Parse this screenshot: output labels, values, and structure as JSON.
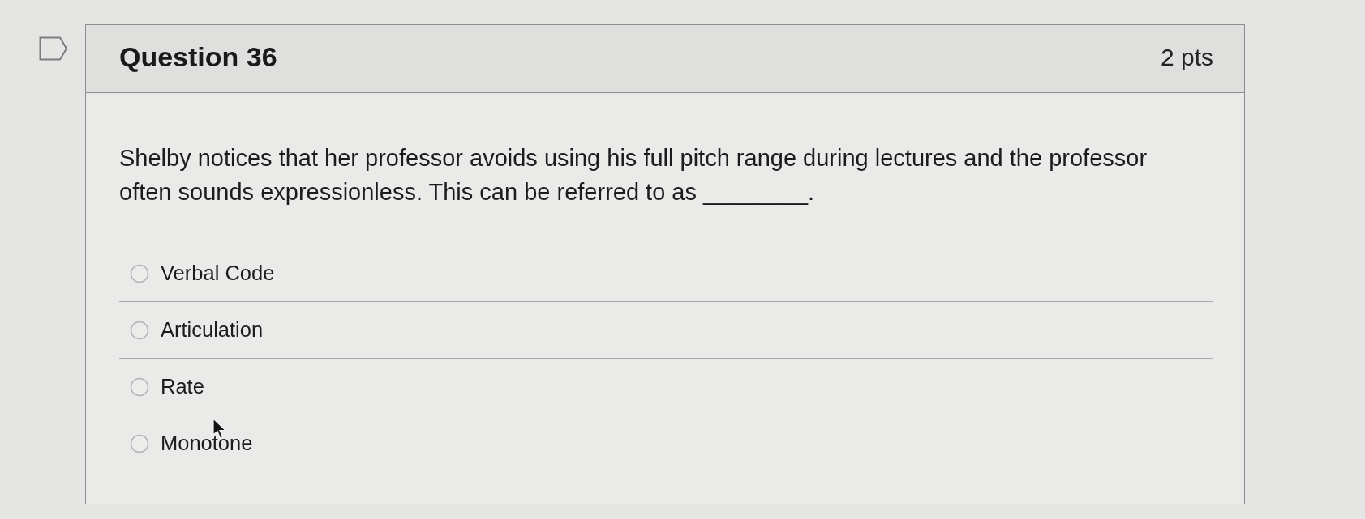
{
  "question": {
    "flagged": false,
    "title": "Question 36",
    "points": "2 pts",
    "text": "Shelby notices that her professor avoids using his full pitch range during lectures and the professor often sounds expressionless. This can be referred to as ________."
  },
  "options": [
    {
      "label": "Verbal Code",
      "selected": false
    },
    {
      "label": "Articulation",
      "selected": false
    },
    {
      "label": "Rate",
      "selected": false
    },
    {
      "label": "Monotone",
      "selected": false
    }
  ]
}
